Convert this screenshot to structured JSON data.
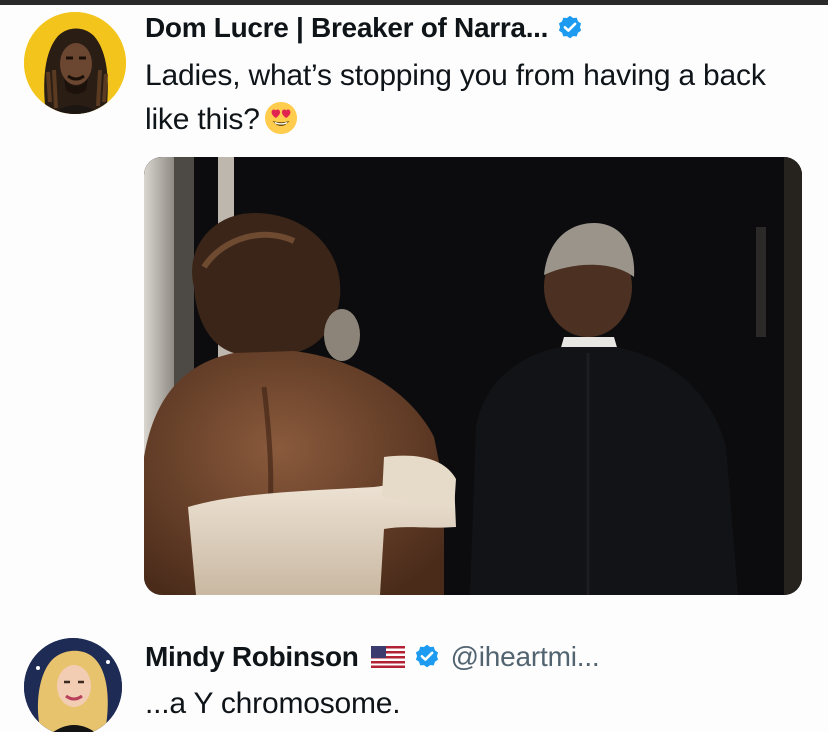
{
  "tweets": [
    {
      "author": {
        "display_name": "Dom Lucre | Breaker of Narra...",
        "verified_icon": "verified-badge-icon",
        "avatar_icon": "avatar-dreadlocks"
      },
      "text": "Ladies, what’s stopping you from having a back like this?",
      "emoji": "heart-eyes-emoji",
      "media": {
        "icon": "photo-two-people-walking-away"
      }
    },
    {
      "author": {
        "display_name": "Mindy Robinson",
        "flag_icon": "us-flag-icon",
        "verified_icon": "verified-badge-icon",
        "handle": "@iheartmi...",
        "avatar_icon": "avatar-blonde-woman"
      },
      "text": "...a Y chromosome."
    }
  ],
  "colors": {
    "verified": "#1d9bf0",
    "text": "#0f1419",
    "secondary_text": "#536471",
    "avatar1_bg": "#f3c51c",
    "avatar2_bg": "#1e2b55"
  }
}
